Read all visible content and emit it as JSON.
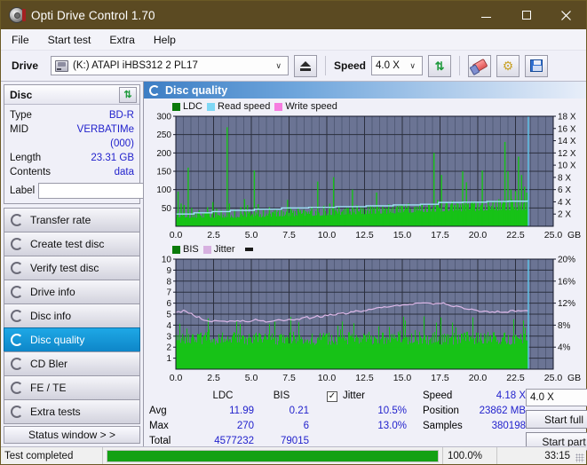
{
  "window": {
    "title": "Opti Drive Control 1.70",
    "app_icon": "disc-icon",
    "minimize": "–",
    "maximize": "□",
    "close": "✕"
  },
  "menubar": {
    "items": [
      "File",
      "Start test",
      "Extra",
      "Help"
    ]
  },
  "toolbar": {
    "drive_label": "Drive",
    "drive_value": "(K:)  ATAPI iHBS312  2 PL17",
    "eject_icon": "eject-icon",
    "speed_label": "Speed",
    "speed_value": "4.0 X",
    "refresh_icon": "refresh-icon",
    "erase_icon": "eraser-icon",
    "tools_icon": "gear-icon",
    "save_icon": "save-icon"
  },
  "disc_panel": {
    "title": "Disc",
    "refresh_icon": "refresh-icon",
    "rows": [
      {
        "key": "Type",
        "value": "BD-R"
      },
      {
        "key": "MID",
        "value": "VERBATIMe (000)"
      },
      {
        "key": "Length",
        "value": "23.31 GB"
      },
      {
        "key": "Contents",
        "value": "data"
      }
    ],
    "label_key": "Label",
    "label_value": "",
    "label_placeholder": "",
    "disc_icon": "cd-icon"
  },
  "sidebar": {
    "items": [
      {
        "label": "Transfer rate",
        "icon": "disc-icon",
        "active": false
      },
      {
        "label": "Create test disc",
        "icon": "disc-icon",
        "active": false
      },
      {
        "label": "Verify test disc",
        "icon": "disc-icon",
        "active": false
      },
      {
        "label": "Drive info",
        "icon": "disc-icon",
        "active": false
      },
      {
        "label": "Disc info",
        "icon": "disc-icon",
        "active": false
      },
      {
        "label": "Disc quality",
        "icon": "disc-icon",
        "active": true
      },
      {
        "label": "CD Bler",
        "icon": "disc-icon",
        "active": false
      },
      {
        "label": "FE / TE",
        "icon": "disc-icon",
        "active": false
      },
      {
        "label": "Extra tests",
        "icon": "disc-icon",
        "active": false
      }
    ],
    "status_window_button": "Status window > >"
  },
  "main": {
    "header_title": "Disc quality",
    "header_icon": "disc-icon"
  },
  "chart_data": [
    {
      "type": "line",
      "title": "LDC / Read speed",
      "legend": [
        {
          "label": "LDC",
          "color": "#0a7a0a"
        },
        {
          "label": "Read speed",
          "color": "#7fd7f5"
        },
        {
          "label": "Write speed",
          "color": "#f67ce0"
        }
      ],
      "legend_position": "top-left",
      "xlabel": "GB",
      "ylabel": "",
      "xlim": [
        0.0,
        25.0
      ],
      "ylim": [
        0,
        300
      ],
      "y2lim": [
        0,
        18
      ],
      "y2label": "X",
      "xticks": [
        "0.0",
        "2.5",
        "5.0",
        "7.5",
        "10.0",
        "12.5",
        "15.0",
        "17.5",
        "20.0",
        "22.5",
        "25.0"
      ],
      "yticks": [
        "300",
        "250",
        "200",
        "150",
        "100",
        "50"
      ],
      "y2ticks": [
        "18 X",
        "16 X",
        "14 X",
        "12 X",
        "10 X",
        "8 X",
        "6 X",
        "4 X",
        "2 X"
      ],
      "grid": true,
      "data_end_gb": 23.35,
      "series": [
        {
          "name": "LDC",
          "color": "#17c217",
          "baseline": [
            32,
            30,
            31,
            33,
            30,
            29,
            31,
            33,
            30,
            29,
            30,
            32,
            31,
            30,
            29,
            30,
            31,
            30,
            29,
            30,
            31,
            32,
            30,
            29,
            31,
            30,
            29,
            30,
            31,
            30,
            29,
            30,
            31,
            32,
            31,
            30,
            29,
            30,
            31,
            30,
            31,
            32,
            31,
            30,
            31,
            32,
            33,
            31,
            30,
            31,
            32,
            33,
            34,
            33,
            32,
            31,
            32,
            33,
            34,
            33,
            32,
            33,
            34,
            33,
            34,
            35,
            34,
            33,
            34,
            35,
            36,
            35,
            34,
            35,
            36,
            35,
            34,
            35,
            36,
            37,
            36,
            35,
            36,
            37,
            36,
            37,
            38,
            37,
            36,
            37,
            38,
            39,
            38,
            37,
            38,
            39,
            38,
            37,
            38,
            39,
            40,
            39,
            38,
            39,
            40,
            41,
            40,
            39,
            40,
            41,
            42,
            41,
            40,
            41,
            42,
            43,
            42,
            41,
            42,
            43,
            44,
            43,
            42,
            43,
            44,
            45,
            44,
            43,
            44,
            45,
            44,
            43,
            44,
            45,
            46,
            45,
            44,
            45,
            46,
            47,
            46,
            45,
            46,
            47,
            48,
            47,
            46,
            47,
            48,
            49,
            48,
            47,
            48,
            49,
            50,
            49,
            48,
            49,
            50,
            51,
            50,
            49,
            50,
            51,
            52,
            51,
            50,
            51,
            52,
            51,
            50,
            51,
            52,
            53,
            52,
            51,
            52,
            53,
            54,
            53,
            52,
            53,
            54,
            53,
            52,
            53,
            54,
            55,
            54,
            53,
            54,
            55,
            54,
            53,
            54,
            55,
            56,
            55,
            54,
            55,
            56,
            55,
            54,
            55,
            56,
            57,
            56,
            55,
            56,
            57,
            56,
            55,
            56,
            57,
            58,
            57,
            56,
            57,
            58,
            57,
            56,
            57,
            58,
            57,
            56,
            57,
            58,
            57
          ],
          "spikes": [
            {
              "x": 0.15,
              "y": 95
            },
            {
              "x": 0.35,
              "y": 62
            },
            {
              "x": 0.55,
              "y": 58
            },
            {
              "x": 0.82,
              "y": 160
            },
            {
              "x": 1.05,
              "y": 50
            },
            {
              "x": 1.55,
              "y": 44
            },
            {
              "x": 2.1,
              "y": 52
            },
            {
              "x": 2.45,
              "y": 66
            },
            {
              "x": 2.7,
              "y": 48
            },
            {
              "x": 3.0,
              "y": 44
            },
            {
              "x": 3.4,
              "y": 270
            },
            {
              "x": 3.55,
              "y": 62
            },
            {
              "x": 3.9,
              "y": 46
            },
            {
              "x": 4.3,
              "y": 52
            },
            {
              "x": 4.55,
              "y": 74
            },
            {
              "x": 4.75,
              "y": 58
            },
            {
              "x": 5.2,
              "y": 152
            },
            {
              "x": 5.45,
              "y": 60
            },
            {
              "x": 5.8,
              "y": 44
            },
            {
              "x": 6.2,
              "y": 52
            },
            {
              "x": 6.6,
              "y": 46
            },
            {
              "x": 7.0,
              "y": 44
            },
            {
              "x": 7.4,
              "y": 72
            },
            {
              "x": 7.6,
              "y": 52
            },
            {
              "x": 8.1,
              "y": 48
            },
            {
              "x": 8.5,
              "y": 44
            },
            {
              "x": 9.0,
              "y": 54
            },
            {
              "x": 9.4,
              "y": 122
            },
            {
              "x": 9.8,
              "y": 56
            },
            {
              "x": 10.2,
              "y": 62
            },
            {
              "x": 10.45,
              "y": 134
            },
            {
              "x": 10.8,
              "y": 52
            },
            {
              "x": 11.2,
              "y": 48
            },
            {
              "x": 11.7,
              "y": 100
            },
            {
              "x": 12.0,
              "y": 58
            },
            {
              "x": 12.4,
              "y": 50
            },
            {
              "x": 12.9,
              "y": 56
            },
            {
              "x": 13.3,
              "y": 92
            },
            {
              "x": 13.7,
              "y": 54
            },
            {
              "x": 14.1,
              "y": 60
            },
            {
              "x": 14.6,
              "y": 52
            },
            {
              "x": 15.0,
              "y": 56
            },
            {
              "x": 15.4,
              "y": 62
            },
            {
              "x": 15.9,
              "y": 54
            },
            {
              "x": 16.3,
              "y": 58
            },
            {
              "x": 16.8,
              "y": 60
            },
            {
              "x": 17.1,
              "y": 200
            },
            {
              "x": 17.35,
              "y": 72
            },
            {
              "x": 17.6,
              "y": 140
            },
            {
              "x": 17.9,
              "y": 64
            },
            {
              "x": 18.3,
              "y": 58
            },
            {
              "x": 18.7,
              "y": 62
            },
            {
              "x": 19.0,
              "y": 150
            },
            {
              "x": 19.25,
              "y": 120
            },
            {
              "x": 19.6,
              "y": 66
            },
            {
              "x": 20.0,
              "y": 64
            },
            {
              "x": 20.3,
              "y": 152
            },
            {
              "x": 20.7,
              "y": 70
            },
            {
              "x": 21.0,
              "y": 68
            },
            {
              "x": 21.4,
              "y": 74
            },
            {
              "x": 21.8,
              "y": 230
            },
            {
              "x": 22.0,
              "y": 150
            },
            {
              "x": 22.2,
              "y": 100
            },
            {
              "x": 22.5,
              "y": 96
            },
            {
              "x": 22.7,
              "y": 190
            },
            {
              "x": 22.9,
              "y": 140
            },
            {
              "x": 23.1,
              "y": 108
            },
            {
              "x": 23.25,
              "y": 92
            }
          ]
        },
        {
          "name": "Read speed",
          "color": "#9fe0f7",
          "steps": [
            {
              "x": 0.0,
              "v": 2.0
            },
            {
              "x": 1.2,
              "v": 2.2
            },
            {
              "x": 2.4,
              "v": 2.4
            },
            {
              "x": 3.6,
              "v": 2.6
            },
            {
              "x": 5.2,
              "v": 2.8
            },
            {
              "x": 7.0,
              "v": 3.0
            },
            {
              "x": 8.8,
              "v": 3.1
            },
            {
              "x": 10.6,
              "v": 3.2
            },
            {
              "x": 12.6,
              "v": 3.35
            },
            {
              "x": 14.4,
              "v": 3.5
            },
            {
              "x": 16.2,
              "v": 3.6
            },
            {
              "x": 17.4,
              "v": 3.9
            },
            {
              "x": 19.0,
              "v": 3.95
            },
            {
              "x": 20.6,
              "v": 4.05
            },
            {
              "x": 22.0,
              "v": 4.1
            },
            {
              "x": 23.3,
              "v": 4.15
            }
          ]
        },
        {
          "name": "Cursor",
          "color": "#5ec8ee",
          "x": 23.35
        }
      ]
    },
    {
      "type": "line",
      "title": "BIS / Jitter",
      "legend": [
        {
          "label": "BIS",
          "color": "#0a7a0a"
        },
        {
          "label": "Jitter",
          "color": "#d7b0e0"
        }
      ],
      "legend_position": "top-left",
      "xlabel": "GB",
      "ylabel": "",
      "xlim": [
        0.0,
        25.0
      ],
      "ylim": [
        0,
        10
      ],
      "y2lim": [
        0,
        20
      ],
      "y2label": "%",
      "xticks": [
        "0.0",
        "2.5",
        "5.0",
        "7.5",
        "10.0",
        "12.5",
        "15.0",
        "17.5",
        "20.0",
        "22.5",
        "25.0"
      ],
      "yticks": [
        "10",
        "9",
        "8",
        "7",
        "6",
        "5",
        "4",
        "3",
        "2",
        "1"
      ],
      "y2ticks": [
        "20%",
        "16%",
        "12%",
        "8%",
        "4%"
      ],
      "grid": true,
      "data_end_gb": 23.35,
      "series": [
        {
          "name": "BIS",
          "color": "#17c217",
          "fill_level": 3.0,
          "peak_level": 4.2
        },
        {
          "name": "Jitter",
          "color": "#dcb8e8",
          "values_pct": [
            10.2,
            10.5,
            10.3,
            10.6,
            10.4,
            10.2,
            10.0,
            9.8,
            9.6,
            9.4,
            9.2,
            9.0,
            8.9,
            8.8,
            8.7,
            8.8,
            8.7,
            8.6,
            8.7,
            8.6,
            8.7,
            8.6,
            8.7,
            8.8,
            8.7,
            8.6,
            8.7,
            8.6,
            8.7,
            8.8,
            8.7,
            9.2,
            8.9,
            8.8,
            8.7,
            8.6,
            8.7,
            8.8,
            8.9,
            8.8,
            8.9,
            9.0,
            8.9,
            9.0,
            9.1,
            9.0,
            9.1,
            9.2,
            9.1,
            9.2,
            9.3,
            9.4,
            9.3,
            9.4,
            9.5,
            9.6,
            9.5,
            9.6,
            9.7,
            9.8,
            9.9,
            10.0,
            9.9,
            10.0,
            10.1,
            10.2,
            10.1,
            10.2,
            10.3,
            10.4,
            10.5,
            10.6,
            10.5,
            10.6,
            10.7,
            10.8,
            10.9,
            11.0,
            11.1,
            11.2,
            11.3,
            11.4,
            11.3,
            11.4,
            11.5,
            11.6,
            11.5,
            11.6,
            11.7,
            11.8,
            11.7,
            11.8,
            11.9,
            11.8,
            11.9,
            12.0,
            11.9,
            12.0,
            11.9,
            12.0,
            11.9,
            11.8,
            11.9,
            12.0,
            11.9,
            11.8,
            11.7,
            11.6,
            11.5,
            11.4,
            11.3,
            11.2,
            11.1,
            11.0,
            10.9,
            10.8,
            10.7,
            10.6,
            10.5,
            10.4,
            10.5,
            10.4,
            10.3,
            10.4,
            10.3,
            10.4,
            10.3,
            10.4,
            10.5,
            10.4,
            10.5,
            10.6,
            10.5,
            10.6,
            10.5,
            10.6,
            10.7,
            10.6
          ]
        },
        {
          "name": "Cursor",
          "color": "#5ec8ee",
          "x": 23.35
        }
      ]
    }
  ],
  "stats": {
    "col_headers": [
      "LDC",
      "BIS"
    ],
    "jitter_label": "Jitter",
    "jitter_checked": true,
    "rows": [
      {
        "label": "Avg",
        "ldc": "11.99",
        "bis": "0.21",
        "jitter": "10.5%"
      },
      {
        "label": "Max",
        "ldc": "270",
        "bis": "6",
        "jitter": "13.0%"
      },
      {
        "label": "Total",
        "ldc": "4577232",
        "bis": "79015",
        "jitter": ""
      }
    ],
    "speed_label": "Speed",
    "speed_value": "4.18 X",
    "position_label": "Position",
    "position_value": "23862 MB",
    "samples_label": "Samples",
    "samples_value": "380198",
    "speed_select": "4.0 X",
    "start_full_button": "Start full",
    "start_part_button": "Start part"
  },
  "statusbar": {
    "text": "Test completed",
    "progress_pct": 100.0,
    "progress_label": "100.0%",
    "elapsed": "33:15"
  }
}
